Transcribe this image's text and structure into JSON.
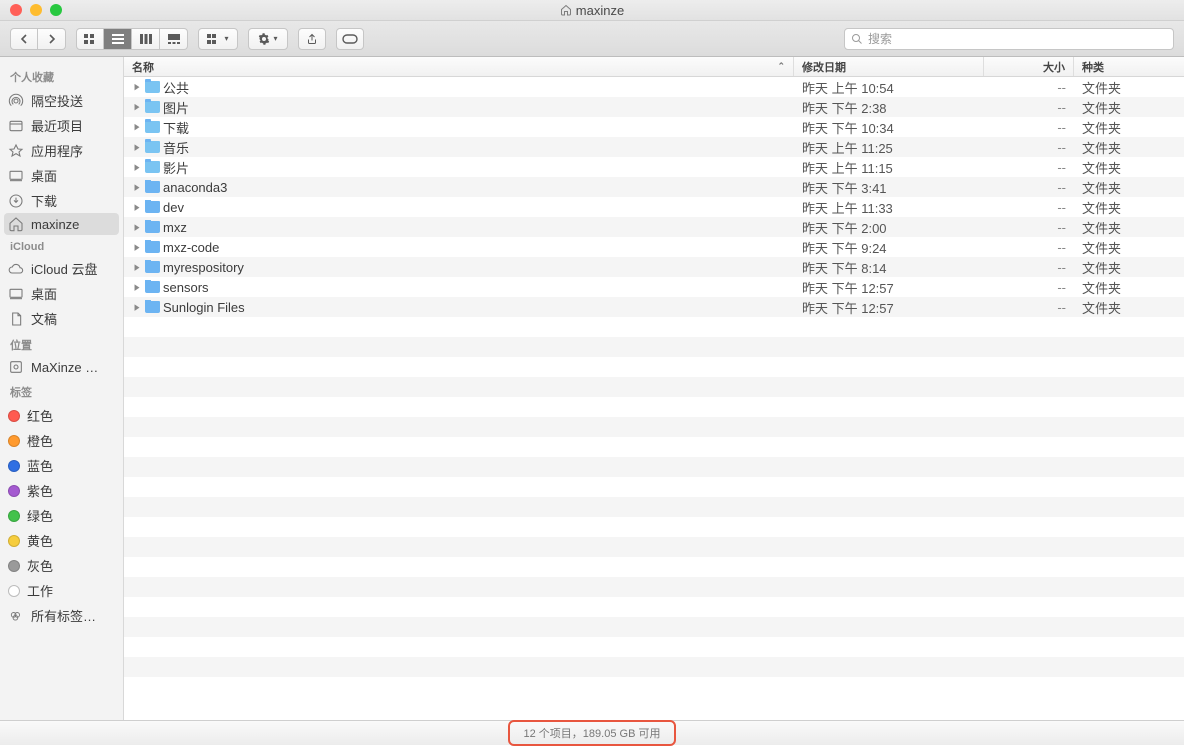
{
  "window_title": "maxinze",
  "search_placeholder": "搜索",
  "sidebar": {
    "favorites_header": "个人收藏",
    "favorites": [
      {
        "icon": "airdrop",
        "label": "隔空投送"
      },
      {
        "icon": "recents",
        "label": "最近项目"
      },
      {
        "icon": "apps",
        "label": "应用程序"
      },
      {
        "icon": "desktop",
        "label": "桌面"
      },
      {
        "icon": "downloads",
        "label": "下载"
      },
      {
        "icon": "home",
        "label": "maxinze",
        "selected": true
      }
    ],
    "icloud_header": "iCloud",
    "icloud": [
      {
        "icon": "cloud",
        "label": "iCloud 云盘"
      },
      {
        "icon": "desktop",
        "label": "桌面"
      },
      {
        "icon": "docs",
        "label": "文稿"
      }
    ],
    "locations_header": "位置",
    "locations": [
      {
        "icon": "disk",
        "label": "MaXinze …"
      }
    ],
    "tags_header": "标签",
    "tags": [
      {
        "color": "#ff5b50",
        "label": "红色"
      },
      {
        "color": "#ff9a2e",
        "label": "橙色"
      },
      {
        "color": "#2f6fe3",
        "label": "蓝色"
      },
      {
        "color": "#a45ad0",
        "label": "紫色"
      },
      {
        "color": "#42c24b",
        "label": "绿色"
      },
      {
        "color": "#f6cd3d",
        "label": "黄色"
      },
      {
        "color": "#9a9a9a",
        "label": "灰色"
      },
      {
        "color": "#ffffff",
        "label": "工作",
        "hollow": true
      },
      {
        "color": "#ffffff",
        "label": "所有标签…",
        "hollow": true,
        "alltags": true
      }
    ]
  },
  "columns": {
    "name": "名称",
    "date": "修改日期",
    "size": "大小",
    "kind": "种类"
  },
  "files": [
    {
      "name": "公共",
      "date": "昨天 上午 10:54",
      "size": "--",
      "kind": "文件夹",
      "sys": true
    },
    {
      "name": "图片",
      "date": "昨天 下午 2:38",
      "size": "--",
      "kind": "文件夹",
      "sys": true
    },
    {
      "name": "下载",
      "date": "昨天 下午 10:34",
      "size": "--",
      "kind": "文件夹",
      "sys": true
    },
    {
      "name": "音乐",
      "date": "昨天 上午 11:25",
      "size": "--",
      "kind": "文件夹",
      "sys": true
    },
    {
      "name": "影片",
      "date": "昨天 上午 11:15",
      "size": "--",
      "kind": "文件夹",
      "sys": true
    },
    {
      "name": "anaconda3",
      "date": "昨天 下午 3:41",
      "size": "--",
      "kind": "文件夹"
    },
    {
      "name": "dev",
      "date": "昨天 上午 11:33",
      "size": "--",
      "kind": "文件夹"
    },
    {
      "name": "mxz",
      "date": "昨天 下午 2:00",
      "size": "--",
      "kind": "文件夹"
    },
    {
      "name": "mxz-code",
      "date": "昨天 下午 9:24",
      "size": "--",
      "kind": "文件夹"
    },
    {
      "name": "myrespository",
      "date": "昨天 下午 8:14",
      "size": "--",
      "kind": "文件夹"
    },
    {
      "name": "sensors",
      "date": "昨天 下午 12:57",
      "size": "--",
      "kind": "文件夹"
    },
    {
      "name": "Sunlogin Files",
      "date": "昨天 下午 12:57",
      "size": "--",
      "kind": "文件夹"
    }
  ],
  "status_text": "12 个项目，189.05 GB 可用"
}
